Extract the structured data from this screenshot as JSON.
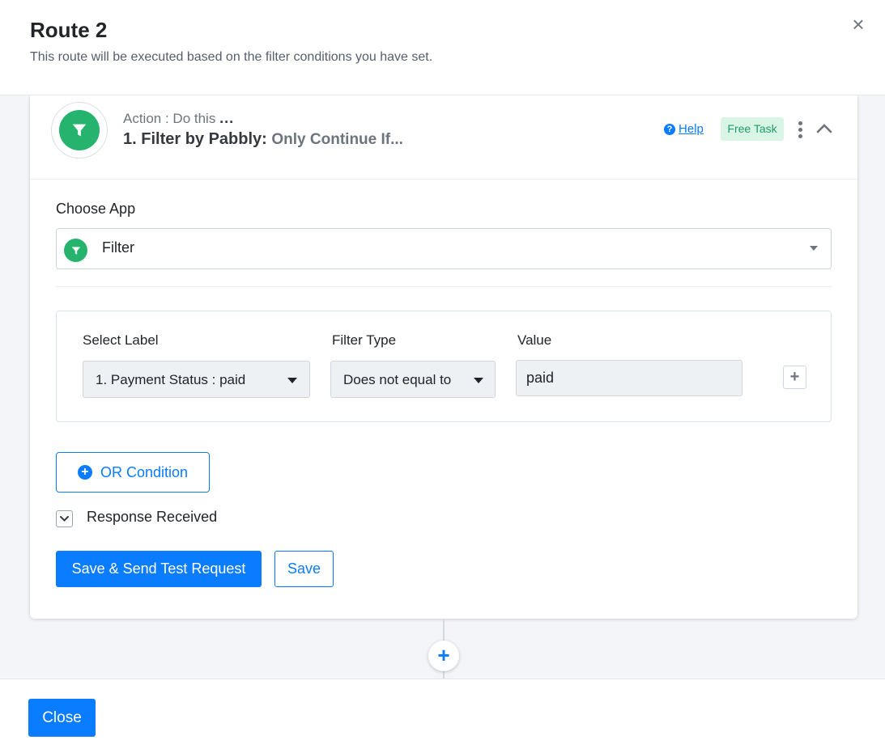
{
  "header": {
    "title": "Route 2",
    "subtitle": "This route will be executed based on the filter conditions you have set.",
    "close_icon": "×"
  },
  "step": {
    "action_prefix": "Action : Do this ",
    "action_dots": "...",
    "title": "1. Filter by Pabbly:",
    "subtitle": "Only Continue If...",
    "help_label": "Help",
    "badge": "Free Task",
    "icon": "filter-icon",
    "app_color": "#26b36e"
  },
  "choose_app": {
    "label": "Choose App",
    "selected": "Filter"
  },
  "filter": {
    "label_header": "Select Label",
    "type_header": "Filter Type",
    "value_header": "Value",
    "label_value": "1. Payment Status : paid",
    "type_value": "Does not equal to",
    "value": "paid"
  },
  "actions": {
    "or_condition": "OR Condition",
    "response_received": "Response Received",
    "save_send": "Save & Send Test Request",
    "save": "Save"
  },
  "footer": {
    "close": "Close"
  },
  "colors": {
    "accent": "#0a7cff",
    "success": "#26b36e",
    "badge_bg": "#d8f5e6"
  }
}
